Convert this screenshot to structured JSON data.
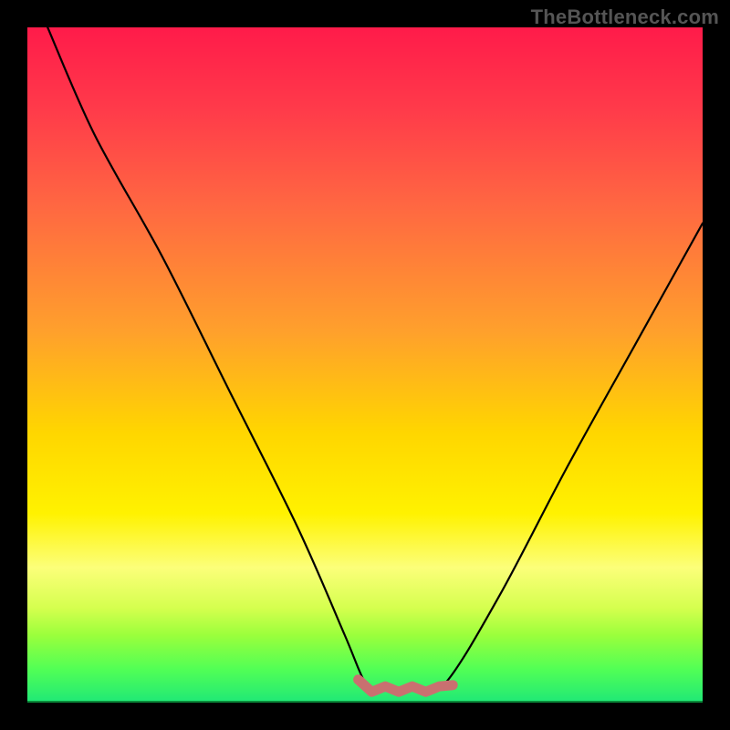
{
  "watermark": "TheBottleneck.com",
  "chart_data": {
    "type": "line",
    "title": "",
    "xlabel": "",
    "ylabel": "",
    "xlim": [
      0,
      100
    ],
    "ylim": [
      0,
      100
    ],
    "grid": false,
    "series": [
      {
        "name": "curve",
        "color": "#000000",
        "x": [
          3,
          10,
          20,
          30,
          40,
          47,
          50,
          52,
          55,
          58,
          62,
          70,
          80,
          90,
          100
        ],
        "values": [
          100,
          84,
          66,
          46,
          26,
          10,
          3,
          2,
          2,
          2,
          3,
          16,
          35,
          53,
          71
        ]
      },
      {
        "name": "flat-bottom-mark",
        "color": "#c97070",
        "x": [
          49,
          51,
          53,
          55,
          57,
          59,
          61,
          63
        ],
        "values": [
          3,
          2,
          2,
          2,
          2,
          2,
          2,
          3
        ]
      }
    ],
    "annotations": []
  }
}
